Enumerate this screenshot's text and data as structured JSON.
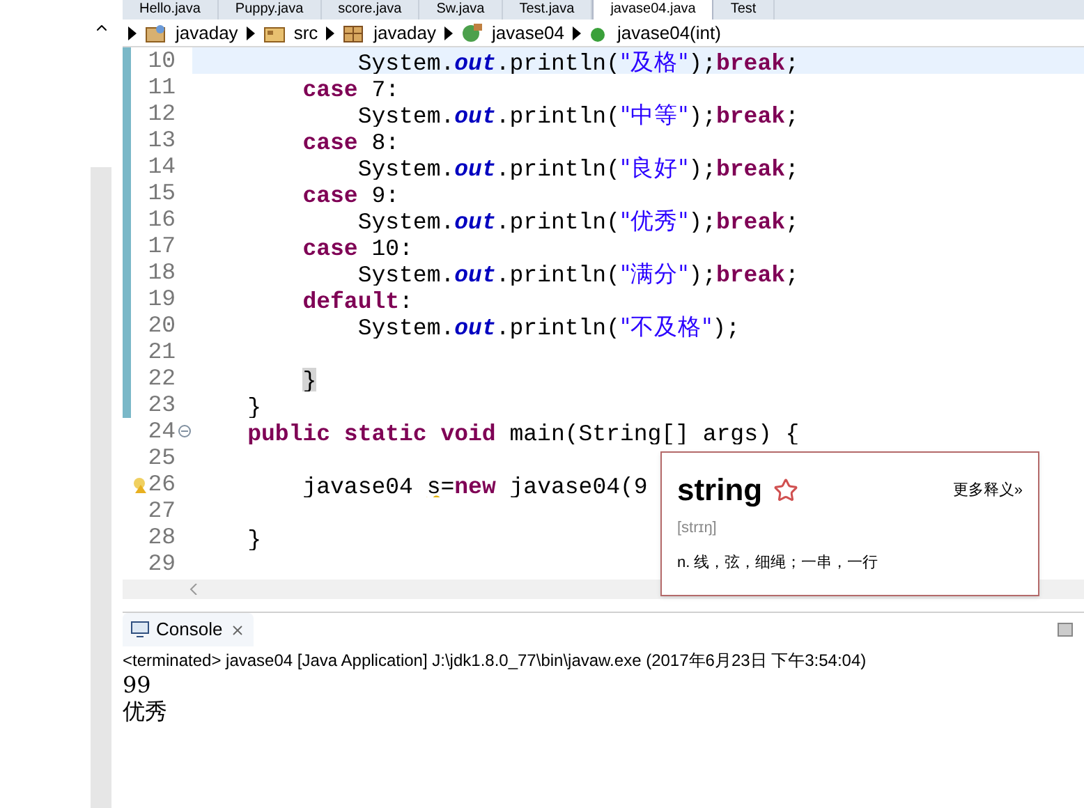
{
  "editor_tabs": [
    {
      "label": "Hello.java",
      "selected": false
    },
    {
      "label": "Puppy.java",
      "selected": false
    },
    {
      "label": "score.java",
      "selected": false
    },
    {
      "label": "Sw.java",
      "selected": false
    },
    {
      "label": "Test.java",
      "selected": false
    },
    {
      "label": "javase04.java",
      "selected": true
    },
    {
      "label": "Test",
      "selected": false
    }
  ],
  "breadcrumb": [
    {
      "label": "javaday",
      "kind": "project"
    },
    {
      "label": "src",
      "kind": "folder"
    },
    {
      "label": "javaday",
      "kind": "package"
    },
    {
      "label": "javase04",
      "kind": "class"
    },
    {
      "label": "javase04(int)",
      "kind": "method"
    }
  ],
  "code_lines": [
    {
      "number": "10",
      "changed": true,
      "current": true,
      "foldable": false,
      "warning": false,
      "tokens": [
        {
          "t": "            System.",
          "kind": "plain"
        },
        {
          "t": "out",
          "kind": "field"
        },
        {
          "t": ".println(",
          "kind": "plain"
        },
        {
          "t": "\"及格\"",
          "kind": "string"
        },
        {
          "t": ");",
          "kind": "plain"
        },
        {
          "t": "break",
          "kind": "keyword"
        },
        {
          "t": ";",
          "kind": "plain"
        }
      ]
    },
    {
      "number": "11",
      "changed": true,
      "current": false,
      "foldable": false,
      "warning": false,
      "tokens": [
        {
          "t": "        case",
          "kind": "keyword"
        },
        {
          "t": " 7:",
          "kind": "plain"
        }
      ]
    },
    {
      "number": "12",
      "changed": true,
      "current": false,
      "foldable": false,
      "warning": false,
      "tokens": [
        {
          "t": "            System.",
          "kind": "plain"
        },
        {
          "t": "out",
          "kind": "field"
        },
        {
          "t": ".println(",
          "kind": "plain"
        },
        {
          "t": "\"中等\"",
          "kind": "string"
        },
        {
          "t": ");",
          "kind": "plain"
        },
        {
          "t": "break",
          "kind": "keyword"
        },
        {
          "t": ";",
          "kind": "plain"
        }
      ]
    },
    {
      "number": "13",
      "changed": true,
      "current": false,
      "foldable": false,
      "warning": false,
      "tokens": [
        {
          "t": "        case",
          "kind": "keyword"
        },
        {
          "t": " 8:",
          "kind": "plain"
        }
      ]
    },
    {
      "number": "14",
      "changed": true,
      "current": false,
      "foldable": false,
      "warning": false,
      "tokens": [
        {
          "t": "            System.",
          "kind": "plain"
        },
        {
          "t": "out",
          "kind": "field"
        },
        {
          "t": ".println(",
          "kind": "plain"
        },
        {
          "t": "\"良好\"",
          "kind": "string"
        },
        {
          "t": ");",
          "kind": "plain"
        },
        {
          "t": "break",
          "kind": "keyword"
        },
        {
          "t": ";",
          "kind": "plain"
        }
      ]
    },
    {
      "number": "15",
      "changed": true,
      "current": false,
      "foldable": false,
      "warning": false,
      "tokens": [
        {
          "t": "        case",
          "kind": "keyword"
        },
        {
          "t": " 9:",
          "kind": "plain"
        }
      ]
    },
    {
      "number": "16",
      "changed": true,
      "current": false,
      "foldable": false,
      "warning": false,
      "tokens": [
        {
          "t": "            System.",
          "kind": "plain"
        },
        {
          "t": "out",
          "kind": "field"
        },
        {
          "t": ".println(",
          "kind": "plain"
        },
        {
          "t": "\"优秀\"",
          "kind": "string"
        },
        {
          "t": ");",
          "kind": "plain"
        },
        {
          "t": "break",
          "kind": "keyword"
        },
        {
          "t": ";",
          "kind": "plain"
        }
      ]
    },
    {
      "number": "17",
      "changed": true,
      "current": false,
      "foldable": false,
      "warning": false,
      "tokens": [
        {
          "t": "        case",
          "kind": "keyword"
        },
        {
          "t": " 10:",
          "kind": "plain"
        }
      ]
    },
    {
      "number": "18",
      "changed": true,
      "current": false,
      "foldable": false,
      "warning": false,
      "tokens": [
        {
          "t": "            System.",
          "kind": "plain"
        },
        {
          "t": "out",
          "kind": "field"
        },
        {
          "t": ".println(",
          "kind": "plain"
        },
        {
          "t": "\"满分\"",
          "kind": "string"
        },
        {
          "t": ");",
          "kind": "plain"
        },
        {
          "t": "break",
          "kind": "keyword"
        },
        {
          "t": ";",
          "kind": "plain"
        }
      ]
    },
    {
      "number": "19",
      "changed": true,
      "current": false,
      "foldable": false,
      "warning": false,
      "tokens": [
        {
          "t": "        default",
          "kind": "keyword"
        },
        {
          "t": ":",
          "kind": "plain"
        }
      ]
    },
    {
      "number": "20",
      "changed": true,
      "current": false,
      "foldable": false,
      "warning": false,
      "tokens": [
        {
          "t": "            System.",
          "kind": "plain"
        },
        {
          "t": "out",
          "kind": "field"
        },
        {
          "t": ".println(",
          "kind": "plain"
        },
        {
          "t": "\"不及格\"",
          "kind": "string"
        },
        {
          "t": ");",
          "kind": "plain"
        }
      ]
    },
    {
      "number": "21",
      "changed": true,
      "current": false,
      "foldable": false,
      "warning": false
    },
    {
      "number": "22",
      "changed": true,
      "current": false,
      "foldable": false,
      "warning": false,
      "tokens": [
        {
          "t": "        }",
          "kind": "match"
        }
      ]
    },
    {
      "number": "23",
      "changed": true,
      "current": false,
      "foldable": false,
      "warning": false,
      "tokens": [
        {
          "t": "    }",
          "kind": "plain"
        }
      ]
    },
    {
      "number": "24",
      "changed": false,
      "current": false,
      "foldable": true,
      "warning": false,
      "tokens": [
        {
          "t": "    public static void",
          "kind": "keyword"
        },
        {
          "t": " main(String[] args) {",
          "kind": "plain"
        }
      ]
    },
    {
      "number": "25",
      "changed": false,
      "current": false,
      "foldable": false,
      "warning": false
    },
    {
      "number": "26",
      "changed": false,
      "current": false,
      "foldable": false,
      "warning": true,
      "tokens": [
        {
          "t": "        javase04 ",
          "kind": "plain"
        },
        {
          "t": "s",
          "kind": "warn"
        },
        {
          "t": "=",
          "kind": "plain"
        },
        {
          "t": "new",
          "kind": "keyword"
        },
        {
          "t": " javase04(9",
          "kind": "plain"
        }
      ]
    },
    {
      "number": "27",
      "changed": false,
      "current": false,
      "foldable": false,
      "warning": false
    },
    {
      "number": "28",
      "changed": false,
      "current": false,
      "foldable": false,
      "warning": false,
      "tokens": [
        {
          "t": "    }",
          "kind": "plain"
        }
      ]
    },
    {
      "number": "29",
      "changed": false,
      "current": false,
      "foldable": false,
      "warning": false
    }
  ],
  "dictionary_popup": {
    "word": "string",
    "more_link": "更多释义»",
    "phonetic": "[strɪŋ]",
    "definition": "n. 线，弦，细绳；一串，一行"
  },
  "console": {
    "tab": "Console",
    "status": "<terminated> javase04 [Java Application] J:\\jdk1.8.0_77\\bin\\javaw.exe (2017年6月23日 下午3:54:04)",
    "output": [
      "99",
      "优秀"
    ]
  }
}
